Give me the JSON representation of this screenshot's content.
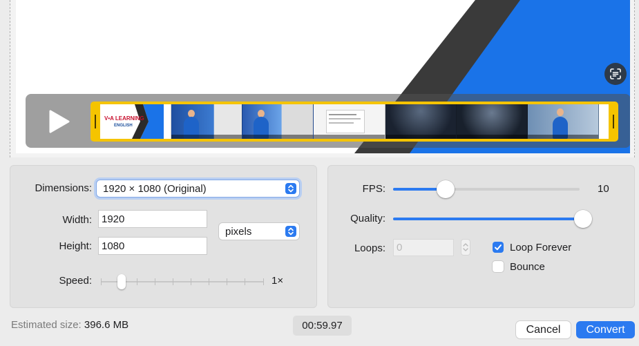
{
  "preview": {
    "logo_text": "V•A LEARNING",
    "logo_sub": "ENGLISH"
  },
  "dimensions": {
    "label": "Dimensions:",
    "selected": "1920 × 1080 (Original)"
  },
  "width": {
    "label": "Width:",
    "value": "1920"
  },
  "height": {
    "label": "Height:",
    "value": "1080"
  },
  "units": {
    "selected": "pixels"
  },
  "speed": {
    "label": "Speed:",
    "value_label": "1×",
    "level": 0.125
  },
  "fps": {
    "label": "FPS:",
    "value": "10",
    "level": 0.28
  },
  "quality": {
    "label": "Quality:",
    "level": 1.0
  },
  "loops": {
    "label": "Loops:",
    "value": "0"
  },
  "loop_forever": {
    "label": "Loop Forever",
    "checked": true
  },
  "bounce": {
    "label": "Bounce",
    "checked": false
  },
  "footer": {
    "estimated_label": "Estimated size:",
    "estimated_value": "396.6 MB",
    "duration": "00:59.97",
    "cancel_label": "Cancel",
    "convert_label": "Convert"
  },
  "colors": {
    "accent": "#2b7af0",
    "trim_handle": "#f5c400",
    "preview_blue": "#1a73e8",
    "preview_dark": "#3a3a3a"
  }
}
